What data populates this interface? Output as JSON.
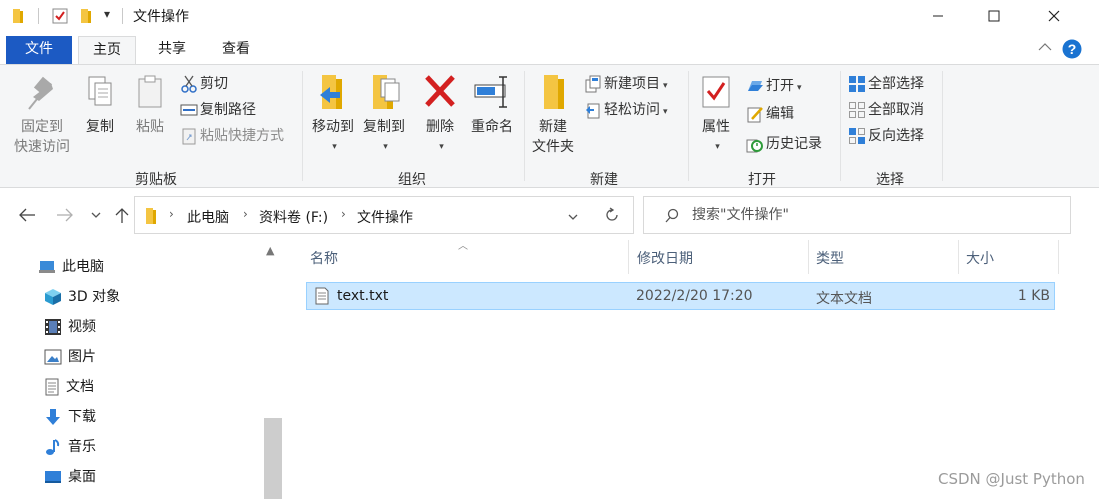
{
  "window": {
    "title": "文件操作",
    "qa_dropdown": "▾"
  },
  "tabs": {
    "file": "文件",
    "home": "主页",
    "share": "共享",
    "view": "查看"
  },
  "ribbon": {
    "clipboard": {
      "label": "剪贴板",
      "pin": [
        "固定到",
        "快速访问"
      ],
      "copy": "复制",
      "paste": "粘贴",
      "cut": "剪切",
      "copy_path": "复制路径",
      "paste_shortcut": "粘贴快捷方式"
    },
    "organize": {
      "label": "组织",
      "move_to": "移动到",
      "copy_to": "复制到",
      "delete": "删除",
      "rename": "重命名"
    },
    "new": {
      "label": "新建",
      "new_folder": [
        "新建",
        "文件夹"
      ],
      "new_item": "新建项目",
      "easy_access": "轻松访问"
    },
    "open": {
      "label": "打开",
      "properties": "属性",
      "open": "打开",
      "edit": "编辑",
      "history": "历史记录"
    },
    "select": {
      "label": "选择",
      "select_all": "全部选择",
      "select_none": "全部取消",
      "invert": "反向选择"
    }
  },
  "address": {
    "crumbs": [
      "此电脑",
      "资料卷 (F:)",
      "文件操作"
    ]
  },
  "search": {
    "placeholder": "搜索\"文件操作\""
  },
  "nav": {
    "items": [
      {
        "label": "此电脑",
        "icon": "computer-icon"
      },
      {
        "label": "3D 对象",
        "icon": "3d-objects-icon"
      },
      {
        "label": "视频",
        "icon": "video-icon"
      },
      {
        "label": "图片",
        "icon": "pictures-icon"
      },
      {
        "label": "文档",
        "icon": "documents-icon"
      },
      {
        "label": "下载",
        "icon": "download-icon"
      },
      {
        "label": "音乐",
        "icon": "music-icon"
      },
      {
        "label": "桌面",
        "icon": "desktop-icon"
      }
    ]
  },
  "files": {
    "columns": [
      "名称",
      "修改日期",
      "类型",
      "大小"
    ],
    "rows": [
      {
        "name": "text.txt",
        "modified": "2022/2/20 17:20",
        "type": "文本文档",
        "size": "1 KB"
      }
    ]
  },
  "watermark": "CSDN @Just Python",
  "colors": {
    "file_tab": "#1c5ac3",
    "selection": "#cce8ff",
    "folder": "#f4c542",
    "delete_red": "#d32020",
    "help_blue": "#1a73d1"
  }
}
